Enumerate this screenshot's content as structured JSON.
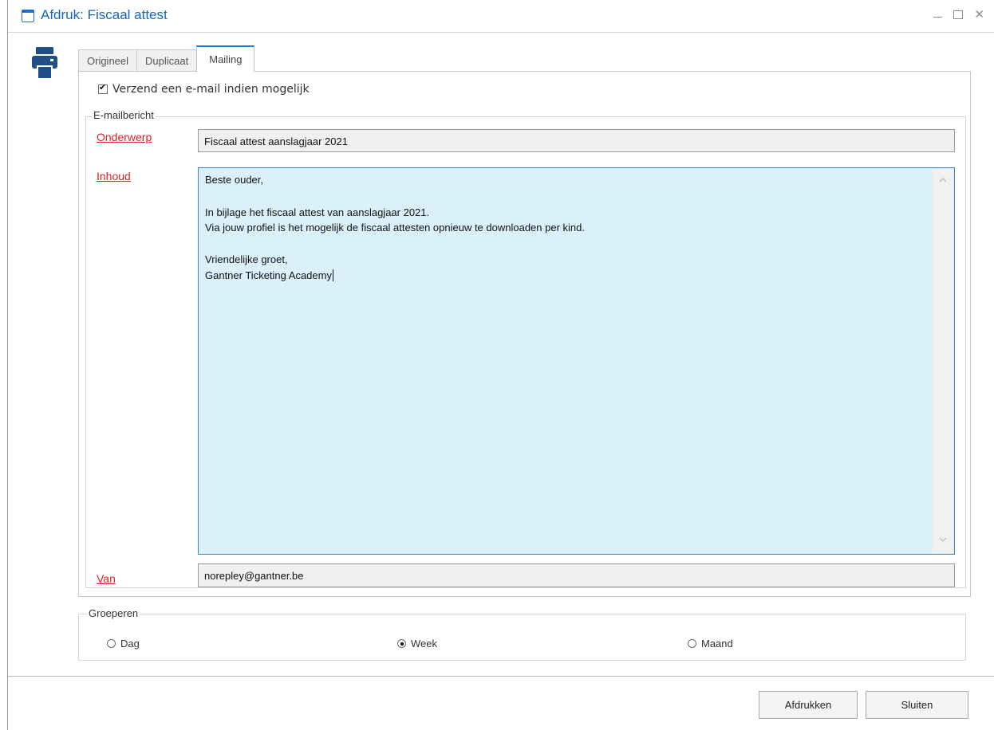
{
  "window": {
    "title": "Afdruk: Fiscaal attest",
    "controls": [
      "minimize-icon",
      "maximize-icon",
      "close-icon"
    ],
    "close_glyph": "✕"
  },
  "tabs": [
    {
      "label": "Origineel",
      "active": false
    },
    {
      "label": "Duplicaat",
      "active": false
    },
    {
      "label": "Mailing",
      "active": true
    }
  ],
  "mailing": {
    "send_email_checkbox": {
      "label": "Verzend een e-mail indien mogelijk",
      "checked": true
    },
    "email_group": {
      "label": "E-mailbericht",
      "subject_label": "Onderwerp",
      "subject_value": "Fiscaal attest aanslagjaar 2021",
      "body_label": "Inhoud",
      "body_lines": [
        "Beste ouder,",
        "",
        "In bijlage het fiscaal attest van aanslagjaar 2021.",
        "Via jouw profiel is het mogelijk de fiscaal attesten opnieuw te downloaden per kind.",
        "",
        "Vriendelijke groet,",
        "Gantner Ticketing Academy"
      ],
      "from_label": "Van",
      "from_value": "norepley@gantner.be"
    }
  },
  "grouping": {
    "label": "Groeperen",
    "options": [
      {
        "label": "Dag",
        "checked": false
      },
      {
        "label": "Week",
        "checked": true
      },
      {
        "label": "Maand",
        "checked": false
      }
    ]
  },
  "buttons": {
    "print": "Afdrukken",
    "close": "Sluiten"
  },
  "colors": {
    "accent": "#1565b8",
    "link_label": "#e02020",
    "textarea_bg": "#daf1fb"
  }
}
